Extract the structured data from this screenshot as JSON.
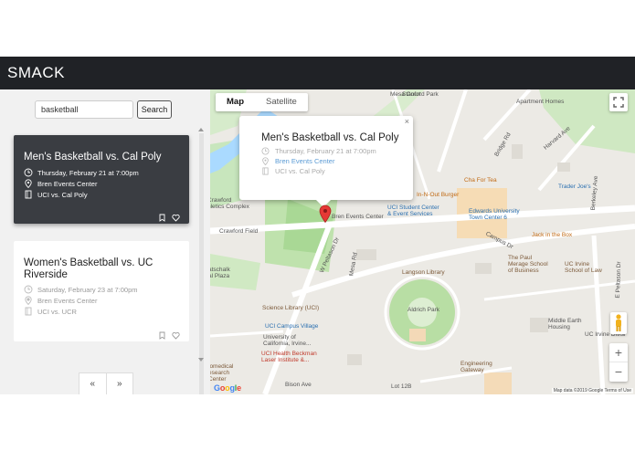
{
  "app": {
    "title": "SMACK"
  },
  "search": {
    "value": "basketball",
    "button_label": "Search"
  },
  "events": [
    {
      "title": "Men's Basketball vs. Cal Poly",
      "date": "Thursday, February 21 at 7:00pm",
      "location": "Bren Events Center",
      "matchup": "UCI vs. Cal Poly",
      "selected": true
    },
    {
      "title": "Women's Basketball vs. UC Riverside",
      "date": "Saturday, February 23 at 7:00pm",
      "location": "Bren Events Center",
      "matchup": "UCI vs. UCR",
      "selected": false
    }
  ],
  "pagination": {
    "prev": "«",
    "next": "»"
  },
  "map": {
    "type_buttons": [
      "Map",
      "Satellite"
    ],
    "active_type": "Map",
    "zoom_in": "+",
    "zoom_out": "−",
    "infowindow": {
      "title": "Men's Basketball vs. Cal Poly",
      "date": "Thursday, February 21 at 7:00pm",
      "location": "Bren Events Center",
      "matchup": "UCI vs. Cal Poly",
      "close": "×"
    },
    "labels": {
      "mesa_court": "Mesa\nCourt",
      "stanford": "Stanford Park",
      "apartment_homes": "Apartment Homes",
      "harvard": "Harvard Ave",
      "cha_for_tea": "Cha For Tea",
      "trader_joes": "Trader Joe's",
      "in_n_out": "In-N-Out Burger",
      "student_center": "UCI Student Center\n& Event Services",
      "edwards": "Edwards University\nTown Center 6",
      "bren": "Bren Events Center",
      "crawford_complex": "Crawford\nhletics Complex",
      "crawford_field": "Crawford Field",
      "jack": "Jack in the Box",
      "paul_merage": "The Paul\nMerage School\nof Business",
      "law": "UC Irvine\nSchool of Law",
      "langson": "Langson Library",
      "science_library": "Science Library (UCI)",
      "campus_village": "UCI Campus Village",
      "aldrich": "Aldrich Park",
      "middle_earth": "Middle Earth\nHousing",
      "uc_irvine_div": "UC Irvine Divisi",
      "university_ca": "University of\nCalifornia, Irvine...",
      "beckman": "UCI Health Beckman\nLaser Institute &...",
      "engineering": "Engineering\nGateway",
      "biomedical": "iomedical\nesearch\nCenter",
      "lot_12b": "Lot 12B",
      "atschalk": "atschalk\nal Plaza",
      "campus_dr": "Campus Dr",
      "w_peltason": "W Peltason Dr",
      "e_peltason": "E Peltason Dr",
      "bridge_rd": "Bridge Rd",
      "berkeley": "Berkeley Ave",
      "mesa_rd": "Mesa Rd",
      "bison": "Bison Ave"
    },
    "attribution": "Map data ©2019 Google   Terms of Use",
    "google": "Google"
  },
  "colors": {
    "header_bg": "#202226",
    "selected_card_bg": "#3a3d42",
    "park_green": "#c3e6b0",
    "marker_red": "#e53935"
  }
}
